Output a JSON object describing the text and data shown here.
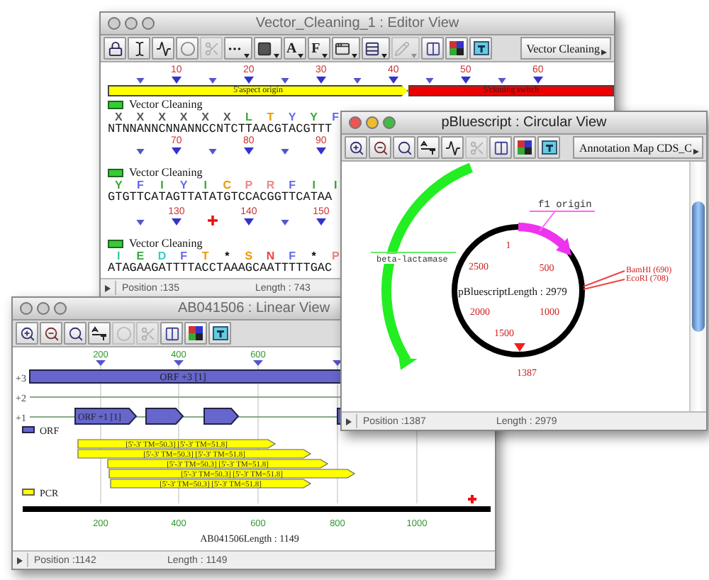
{
  "editor": {
    "title": "Vector_Cleaning_1 : Editor View",
    "active": false,
    "toolbar": [
      {
        "kind": "lock",
        "disabled": false
      },
      {
        "kind": "cursor",
        "disabled": false
      },
      {
        "kind": "wave",
        "disabled": false
      },
      {
        "kind": "circle",
        "disabled": false
      },
      {
        "kind": "scissors",
        "disabled": true
      },
      {
        "kind": "dots",
        "disabled": false,
        "menu": true
      },
      {
        "kind": "rect",
        "disabled": false,
        "menu": true
      },
      {
        "kind": "letter",
        "label": "A",
        "disabled": false,
        "menu": true
      },
      {
        "kind": "letter",
        "label": "F",
        "disabled": false,
        "menu": true
      },
      {
        "kind": "window",
        "disabled": false,
        "menu": true
      },
      {
        "kind": "ladder",
        "disabled": false,
        "menu": true
      },
      {
        "kind": "pencil",
        "disabled": true,
        "menu": true
      },
      {
        "kind": "panel",
        "disabled": false
      },
      {
        "kind": "color",
        "disabled": false
      },
      {
        "kind": "text_panel",
        "disabled": false
      }
    ],
    "dropdown": "Vector Cleaning",
    "features": [
      {
        "kind": "arrow",
        "label": "5'aspect origin",
        "color": "#ffff00"
      },
      {
        "kind": "bar",
        "label": "5'cloning switch",
        "color": "#ee0000"
      }
    ],
    "blocks": [
      {
        "ticks": [
          {
            "cursor": false
          },
          {
            "label": "10",
            "cursor": false
          },
          {
            "cursor": false
          },
          {
            "label": "20",
            "cursor": false
          },
          {
            "cursor": false
          },
          {
            "label": "30",
            "cursor": false
          },
          {
            "cursor": false
          },
          {
            "label": "40",
            "cursor": false
          },
          {
            "cursor": false
          },
          {
            "label": "50",
            "cursor": false
          },
          {
            "cursor": false
          },
          {
            "label": "60",
            "cursor": false
          }
        ],
        "track": "Vector Cleaning",
        "translation": [
          {
            "aa": "X",
            "color": "#555555"
          },
          {
            "aa": "X",
            "color": "#555555"
          },
          {
            "aa": "X",
            "color": "#555555"
          },
          {
            "aa": "X",
            "color": "#555555"
          },
          {
            "aa": "X",
            "color": "#555555"
          },
          {
            "aa": "X",
            "color": "#555555"
          },
          {
            "aa": "L",
            "color": "#33aa33"
          },
          {
            "aa": "T",
            "color": "#ee9900"
          },
          {
            "aa": "Y",
            "color": "#6666ee"
          },
          {
            "aa": "Y",
            "color": "#33aa33"
          },
          {
            "aa": "F",
            "color": "#6666ee"
          }
        ],
        "sequence": "NTNNANNCNNANNCCNTCTTAACGTACGTTT"
      },
      {
        "ticks": [
          {
            "cursor": false
          },
          {
            "label": "70",
            "cursor": false
          },
          {
            "cursor": false
          },
          {
            "label": "80",
            "cursor": false
          },
          {
            "cursor": false
          },
          {
            "label": "90",
            "cursor": false
          }
        ],
        "track": "Vector Cleaning",
        "translation": [
          {
            "aa": "Y",
            "color": "#33aa33"
          },
          {
            "aa": "F",
            "color": "#6666ee"
          },
          {
            "aa": "I",
            "color": "#33aa33"
          },
          {
            "aa": "Y",
            "color": "#6666ee"
          },
          {
            "aa": "I",
            "color": "#33aa33"
          },
          {
            "aa": "C",
            "color": "#ee9900"
          },
          {
            "aa": "P",
            "color": "#ee8888"
          },
          {
            "aa": "R",
            "color": "#ee8888"
          },
          {
            "aa": "F",
            "color": "#6666ee"
          },
          {
            "aa": "I",
            "color": "#33aa33"
          },
          {
            "aa": "I",
            "color": "#33aa33"
          }
        ],
        "sequence": "GTGTTCATAGTTATATGTCCACGGTTCATAA"
      },
      {
        "ticks": [
          {
            "cursor": false
          },
          {
            "label": "130",
            "cursor": false
          },
          {
            "cursor": true
          },
          {
            "label": "140",
            "cursor": false
          },
          {
            "cursor": false
          },
          {
            "label": "150",
            "cursor": false
          }
        ],
        "track": "Vector Cleaning",
        "translation": [
          {
            "aa": "I",
            "color": "#33cc99"
          },
          {
            "aa": "E",
            "color": "#33aa33"
          },
          {
            "aa": "D",
            "color": "#33cccc"
          },
          {
            "aa": "F",
            "color": "#6666ee"
          },
          {
            "aa": "T",
            "color": "#ee9900"
          },
          {
            "aa": "*",
            "color": "#000000"
          },
          {
            "aa": "S",
            "color": "#ee9900"
          },
          {
            "aa": "N",
            "color": "#ee4444"
          },
          {
            "aa": "F",
            "color": "#6666ee"
          },
          {
            "aa": "*",
            "color": "#000000"
          },
          {
            "aa": "P",
            "color": "#ee8888"
          }
        ],
        "sequence": "ATAGAAGATTTTACCTAAAGCAATTTTTGAC"
      }
    ],
    "status": {
      "position": "Position :135",
      "length": "Length : 743"
    }
  },
  "linear": {
    "title": "AB041506 : Linear View",
    "active": false,
    "toolbar": [
      {
        "kind": "zoom_in",
        "disabled": false
      },
      {
        "kind": "zoom_out",
        "disabled": false
      },
      {
        "kind": "zoom_fit",
        "disabled": false
      },
      {
        "kind": "sort",
        "disabled": false
      },
      {
        "kind": "circle",
        "disabled": true
      },
      {
        "kind": "scissors",
        "disabled": true
      },
      {
        "kind": "panel",
        "disabled": false
      },
      {
        "kind": "color",
        "disabled": false
      },
      {
        "kind": "text_panel",
        "disabled": false
      }
    ],
    "top_ticks": [
      "200",
      "400",
      "600"
    ],
    "frames": [
      "+3",
      "+2",
      "+1"
    ],
    "orf3": "ORF +3 [1]",
    "orf1": "ORF +1 [1]",
    "legend_orf": "ORF",
    "legend_pcr": "PCR",
    "pcr": [
      "[5'-3' TM=50.3] [5'-3' TM=51.8]",
      "[5'-3' TM=50.3] [5'-3' TM=51.8]",
      "[5'-3' TM=50.3] [5'-3' TM=51.8]",
      "[5'-3' TM=50.3] [5'-3' TM=51.8]",
      "[5'-3' TM=50.3] [5'-3' TM=51.8]"
    ],
    "bottom_ticks": [
      "200",
      "400",
      "600",
      "800",
      "1000"
    ],
    "caption": "AB041506Length : 1149",
    "status": {
      "position": "Position :1142",
      "length": "Length : 1149"
    }
  },
  "circular": {
    "title": "pBluescript : Circular View",
    "active": true,
    "toolbar": [
      {
        "kind": "zoom_in",
        "disabled": false
      },
      {
        "kind": "zoom_out",
        "disabled": false
      },
      {
        "kind": "zoom_fit",
        "disabled": false
      },
      {
        "kind": "sort",
        "disabled": false
      },
      {
        "kind": "wave",
        "disabled": false
      },
      {
        "kind": "scissors",
        "disabled": true
      },
      {
        "kind": "panel",
        "disabled": false
      },
      {
        "kind": "color",
        "disabled": false
      },
      {
        "kind": "text_panel",
        "disabled": false
      }
    ],
    "dropdown": "Annotation Map CDS_C",
    "f1": "f1 origin",
    "beta": "beta-lactamase",
    "positions": [
      "1",
      "500",
      "1000",
      "1500",
      "2000",
      "2500"
    ],
    "center": "pBluescriptLength : 2979",
    "sites": [
      "BamHI (690)",
      "EcoRI (708)"
    ],
    "cursor": "1387",
    "status": {
      "position": "Position :1387",
      "length": "Length : 2979"
    }
  }
}
